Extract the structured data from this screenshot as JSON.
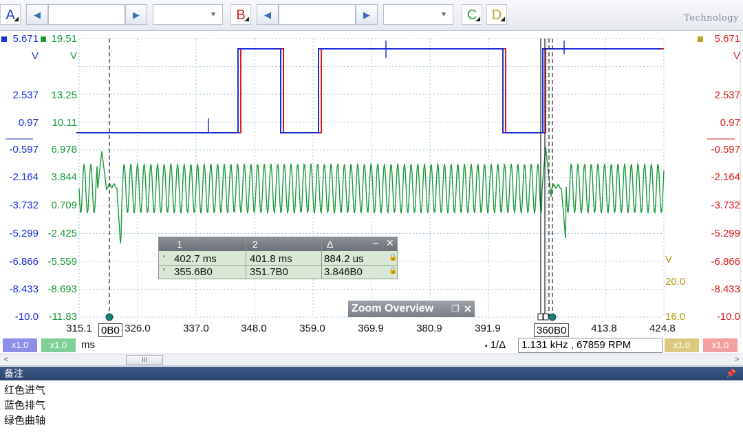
{
  "toolbar": {
    "channels": [
      {
        "id": "A",
        "color": "#1f3fd0"
      },
      {
        "id": "B",
        "color": "#d02020"
      },
      {
        "id": "C",
        "color": "#2a9a3a"
      },
      {
        "id": "D",
        "color": "#b8a020"
      }
    ],
    "logo_text": "Technology"
  },
  "axes": {
    "left_blue": [
      "5.671",
      "V",
      "2.537",
      "0.97",
      "-0.597",
      "-2.164",
      "-3.732",
      "-5.299",
      "-6.866",
      "-8.433",
      "-10.0"
    ],
    "left_green": [
      "19.51",
      "V",
      "13.25",
      "10.11",
      "6.978",
      "3.844",
      "0.709",
      "-2.425",
      "-5.559",
      "-8.693",
      "-11.83"
    ],
    "right_red": [
      "5.671",
      "V",
      "2.537",
      "0.97",
      "-0.597",
      "-2.164",
      "-3.732",
      "-5.299",
      "-6.866",
      "-8.433",
      "-10.0"
    ],
    "gold": [
      "V",
      "20.0",
      "16.0"
    ],
    "x_ticks": [
      "315.1",
      "326.0",
      "337.0",
      "348.0",
      "359.0",
      "369.9",
      "380.9",
      "391.9",
      "413.8",
      "424.8"
    ],
    "x_unit": "ms"
  },
  "cursors": {
    "left_tag": "0B0",
    "right_tag": "360B0"
  },
  "measure_table": {
    "headers": [
      "1",
      "2",
      "Δ"
    ],
    "rows": [
      [
        "402.7 ms",
        "401.8 ms",
        "884.2 us"
      ],
      [
        "355.6B0",
        "351.7B0",
        "3.846B0"
      ]
    ]
  },
  "zoom_overview": "Zoom Overview",
  "status": {
    "scale_left_1": "x1.0",
    "scale_left_2": "x1.0",
    "unit": "ms",
    "one_delta": "1/Δ",
    "frequency": "1.131 kHz , 67859 RPM",
    "scale_right_1": "x1.0",
    "scale_right_2": "x1.0"
  },
  "notes": {
    "title": "备注",
    "lines": [
      "红色进气",
      "蓝色排气",
      "绿色曲轴"
    ]
  },
  "colors": {
    "blue": "#1a2fd8",
    "red": "#e01a1a",
    "green": "#1a9a3a",
    "gold": "#b89a10",
    "grid": "#9ec4e0"
  }
}
